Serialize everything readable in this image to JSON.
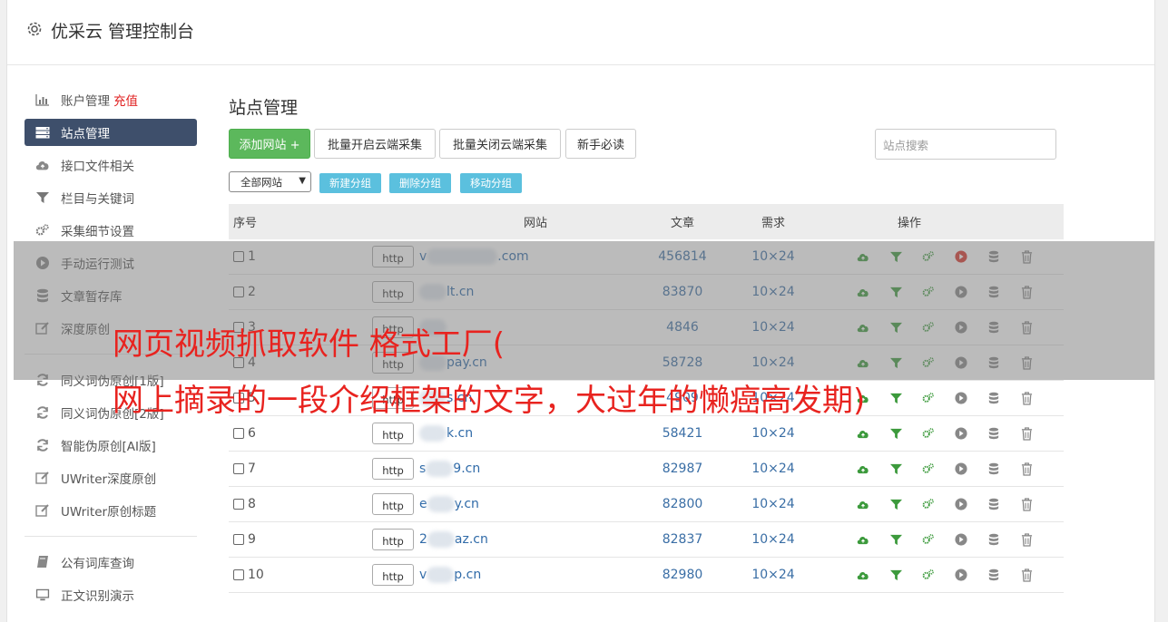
{
  "app": {
    "title": "优采云 管理控制台"
  },
  "sidebar": {
    "items": [
      {
        "label": "账户管理",
        "extra": "充值",
        "icon": "bar-chart-icon"
      },
      {
        "label": "站点管理",
        "icon": "server-icon",
        "active": true
      },
      {
        "label": "接口文件相关",
        "icon": "cloud-upload-icon"
      },
      {
        "label": "栏目与关键词",
        "icon": "filter-icon"
      },
      {
        "label": "采集细节设置",
        "icon": "gears-icon"
      },
      {
        "label": "手动运行测试",
        "icon": "play-icon"
      },
      {
        "label": "文章暂存库",
        "icon": "database-icon"
      },
      {
        "label": "深度原创",
        "icon": "edit-icon"
      },
      {
        "label": "同义词伪原创[1版]",
        "icon": "refresh-icon"
      },
      {
        "label": "同义词伪原创[2版]",
        "icon": "refresh-icon"
      },
      {
        "label": "智能伪原创[AI版]",
        "icon": "refresh-icon"
      },
      {
        "label": "UWriter深度原创",
        "icon": "edit-icon"
      },
      {
        "label": "UWriter原创标题",
        "icon": "edit-icon"
      },
      {
        "label": "公有词库查询",
        "icon": "book-icon"
      },
      {
        "label": "正文识别演示",
        "icon": "monitor-icon"
      }
    ]
  },
  "main": {
    "title": "站点管理",
    "buttons": {
      "add_site": "添加网站 +",
      "batch_open": "批量开启云端采集",
      "batch_close": "批量关闭云端采集",
      "newbie": "新手必读"
    },
    "search_placeholder": "站点搜索",
    "group_select": "全部网站",
    "group_buttons": {
      "new": "新建分组",
      "delete": "删除分组",
      "move": "移动分组"
    }
  },
  "table": {
    "headers": {
      "no": "序号",
      "site": "网站",
      "articles": "文章",
      "need": "需求",
      "ops": "操作"
    },
    "rows": [
      {
        "no": "1",
        "prefix": "http",
        "site_start": "v",
        "site_end": ".com",
        "articles": "456814",
        "need": "10×24",
        "run_active": true
      },
      {
        "no": "2",
        "prefix": "http",
        "site_start": "",
        "site_end": "lt.cn",
        "articles": "83870",
        "need": "10×24"
      },
      {
        "no": "3",
        "prefix": "http",
        "site_start": "",
        "site_end": "",
        "articles": "4846",
        "need": "10×24"
      },
      {
        "no": "4",
        "prefix": "http",
        "site_start": "",
        "site_end": "pay.cn",
        "articles": "58728",
        "need": "10×24"
      },
      {
        "no": "5",
        "prefix": "http",
        "site_start": "",
        "site_end": "s.cn",
        "articles": "4909",
        "need": "10×24"
      },
      {
        "no": "6",
        "prefix": "http",
        "site_start": "",
        "site_end": "k.cn",
        "articles": "58421",
        "need": "10×24"
      },
      {
        "no": "7",
        "prefix": "http",
        "site_start": "s",
        "site_end": "9.cn",
        "articles": "82987",
        "need": "10×24"
      },
      {
        "no": "8",
        "prefix": "http",
        "site_start": "e",
        "site_end": "y.cn",
        "articles": "82800",
        "need": "10×24"
      },
      {
        "no": "9",
        "prefix": "http",
        "site_start": "2",
        "site_end": "az.cn",
        "articles": "82837",
        "need": "10×24"
      },
      {
        "no": "10",
        "prefix": "http",
        "site_start": "v",
        "site_end": "p.cn",
        "articles": "82980",
        "need": "10×24"
      }
    ]
  },
  "overlay": {
    "line1": "网页视频抓取软件 格式工厂(",
    "line2": "网上摘录的一段介绍框架的文字，大过年的懒癌高发期)"
  },
  "colors": {
    "accent_green": "#5cb85c",
    "accent_info": "#5bc0de",
    "sidebar_active": "#3e4f6b",
    "overlay_red": "#e8231f"
  }
}
